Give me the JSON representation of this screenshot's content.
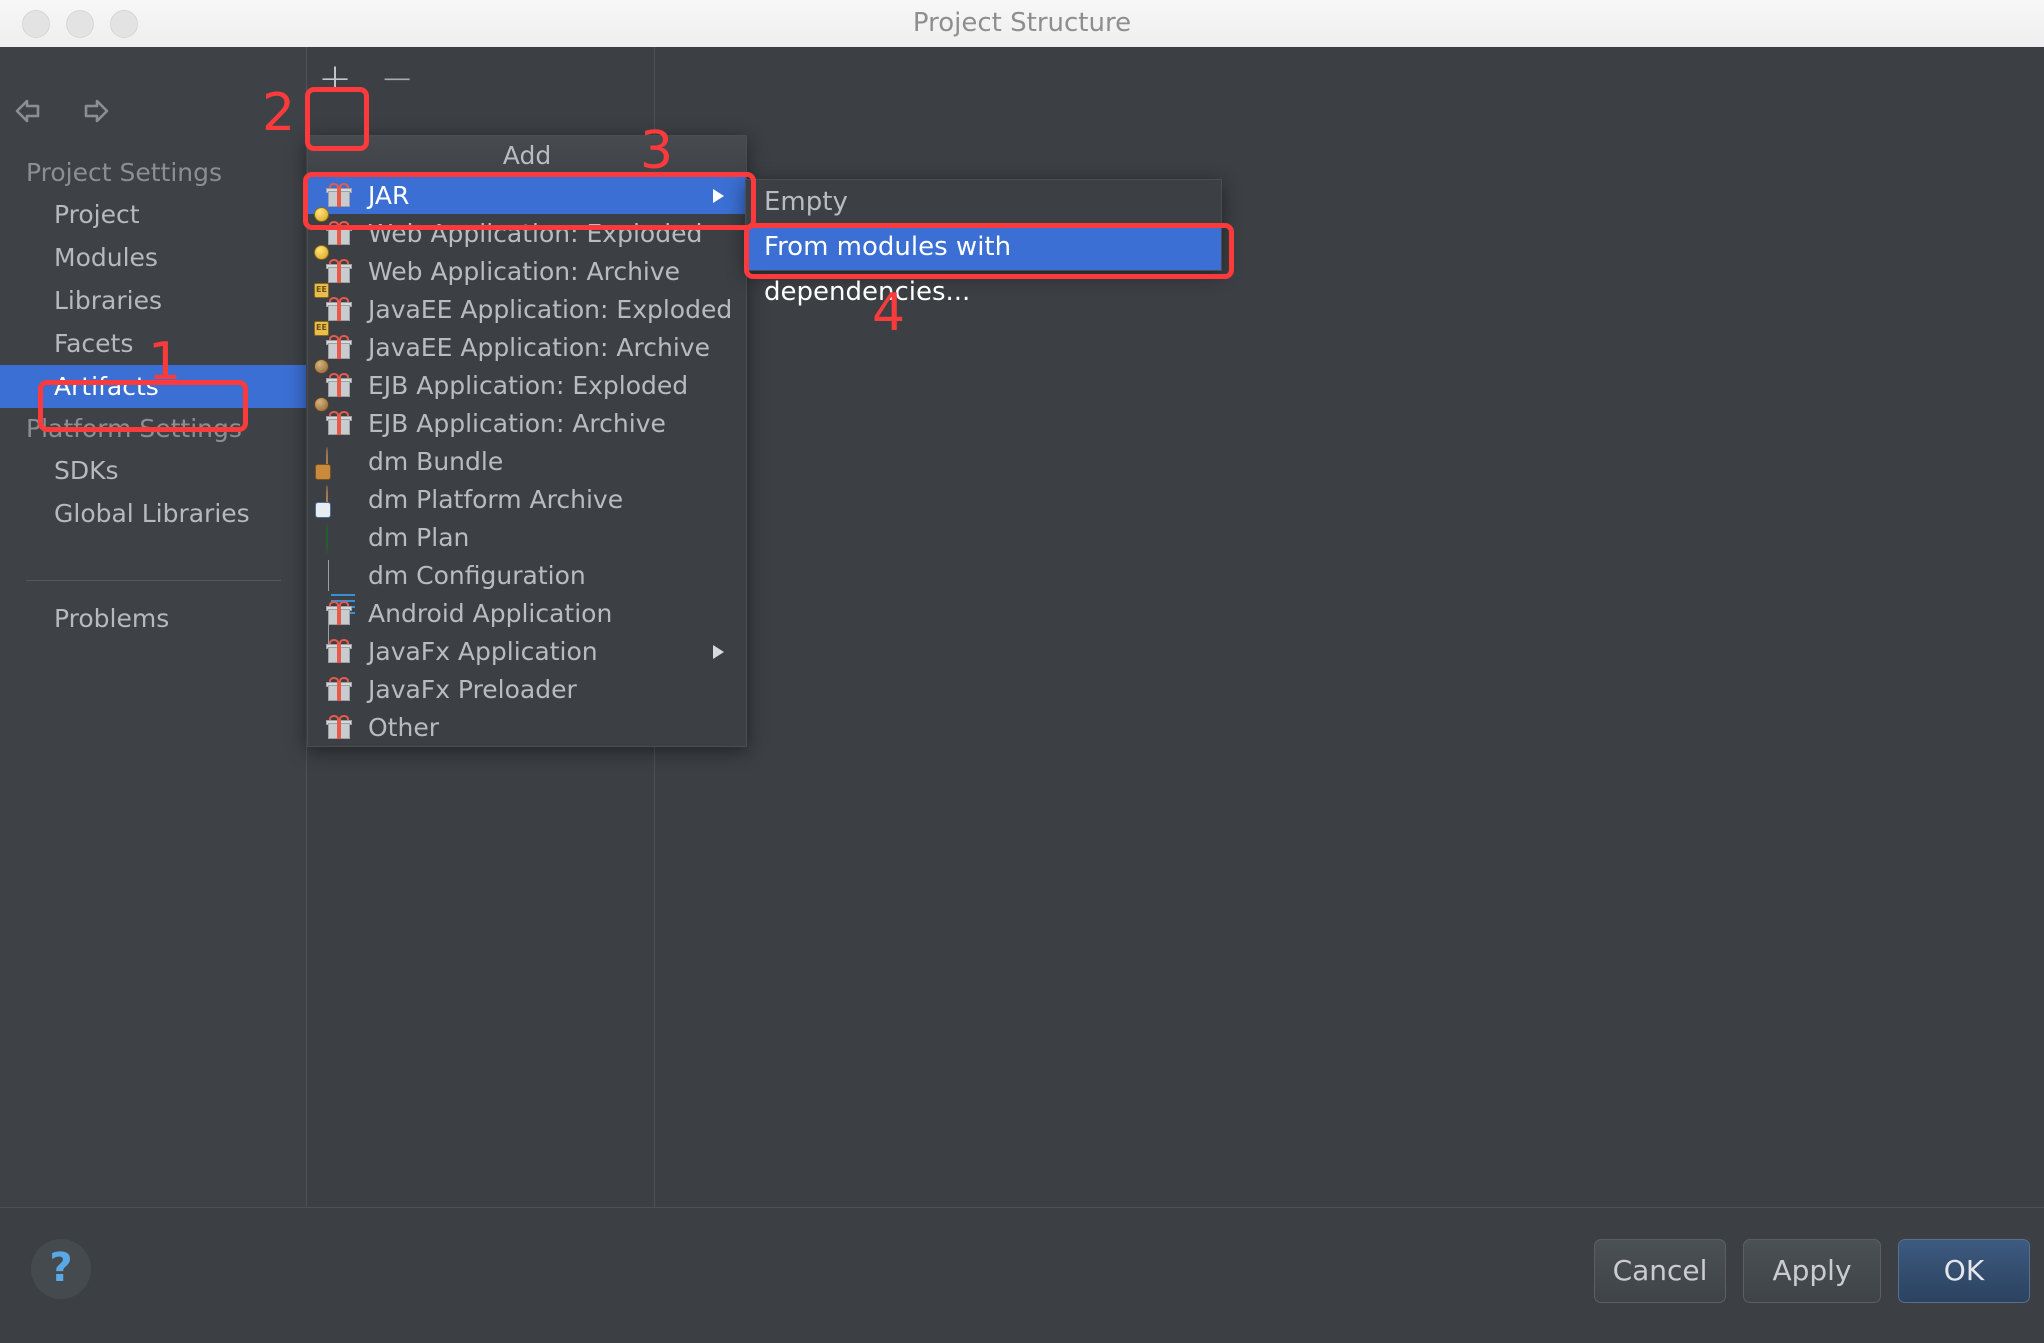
{
  "window": {
    "title": "Project Structure",
    "traffic_lights": [
      "close-button",
      "minimize-button",
      "zoom-button"
    ]
  },
  "toolbar": {
    "back_icon": "back-arrow-icon",
    "forward_icon": "forward-arrow-icon",
    "add_label": "+",
    "remove_label": "−"
  },
  "sidebar": {
    "groups": [
      {
        "label": "Project Settings",
        "items": [
          {
            "label": "Project",
            "selected": false
          },
          {
            "label": "Modules",
            "selected": false
          },
          {
            "label": "Libraries",
            "selected": false
          },
          {
            "label": "Facets",
            "selected": false
          },
          {
            "label": "Artifacts",
            "selected": true
          }
        ]
      },
      {
        "label": "Platform Settings",
        "items": [
          {
            "label": "SDKs",
            "selected": false
          },
          {
            "label": "Global Libraries",
            "selected": false
          }
        ]
      }
    ],
    "problems": {
      "label": "Problems"
    }
  },
  "add_menu": {
    "header": "Add",
    "items": [
      {
        "label": "JAR",
        "icon": "gift-icon",
        "selected": true,
        "has_submenu": true
      },
      {
        "label": "Web Application: Exploded",
        "icon": "gift-web-icon",
        "selected": false,
        "has_submenu": false
      },
      {
        "label": "Web Application: Archive",
        "icon": "gift-web-icon",
        "selected": false,
        "has_submenu": false
      },
      {
        "label": "JavaEE Application: Exploded",
        "icon": "gift-ee-icon",
        "selected": false,
        "has_submenu": false
      },
      {
        "label": "JavaEE Application: Archive",
        "icon": "gift-ee-icon",
        "selected": false,
        "has_submenu": false
      },
      {
        "label": "EJB Application: Exploded",
        "icon": "gift-ejb-icon",
        "selected": false,
        "has_submenu": false
      },
      {
        "label": "EJB Application: Archive",
        "icon": "gift-ejb-icon",
        "selected": false,
        "has_submenu": false
      },
      {
        "label": "dm Bundle",
        "icon": "dm-bundle-icon",
        "selected": false,
        "has_submenu": false
      },
      {
        "label": "dm Platform Archive",
        "icon": "dm-platform-archive-icon",
        "selected": false,
        "has_submenu": false
      },
      {
        "label": "dm Plan",
        "icon": "dm-plan-icon",
        "selected": false,
        "has_submenu": false
      },
      {
        "label": "dm Configuration",
        "icon": "dm-configuration-icon",
        "selected": false,
        "has_submenu": false
      },
      {
        "label": "Android Application",
        "icon": "gift-icon",
        "selected": false,
        "has_submenu": false
      },
      {
        "label": "JavaFx Application",
        "icon": "gift-icon",
        "selected": false,
        "has_submenu": true
      },
      {
        "label": "JavaFx Preloader",
        "icon": "gift-icon",
        "selected": false,
        "has_submenu": false
      },
      {
        "label": "Other",
        "icon": "gift-icon",
        "selected": false,
        "has_submenu": false
      }
    ]
  },
  "jar_submenu": {
    "items": [
      {
        "label": "Empty",
        "selected": false
      },
      {
        "label": "From modules with dependencies...",
        "selected": true
      }
    ]
  },
  "annotations": {
    "accent_color": "#fb3b3b",
    "steps": [
      {
        "number": "1",
        "target": "Artifacts"
      },
      {
        "number": "2",
        "target": "Add (+) button"
      },
      {
        "number": "3",
        "target": "JAR"
      },
      {
        "number": "4",
        "target": "From modules with dependencies..."
      }
    ]
  },
  "footer": {
    "help_label": "?",
    "cancel_label": "Cancel",
    "apply_label": "Apply",
    "ok_label": "OK"
  },
  "colors": {
    "selection_blue": "#3b6fd4",
    "window_bg": "#3c4044",
    "titlebar_bg": "#f2f2f2"
  }
}
